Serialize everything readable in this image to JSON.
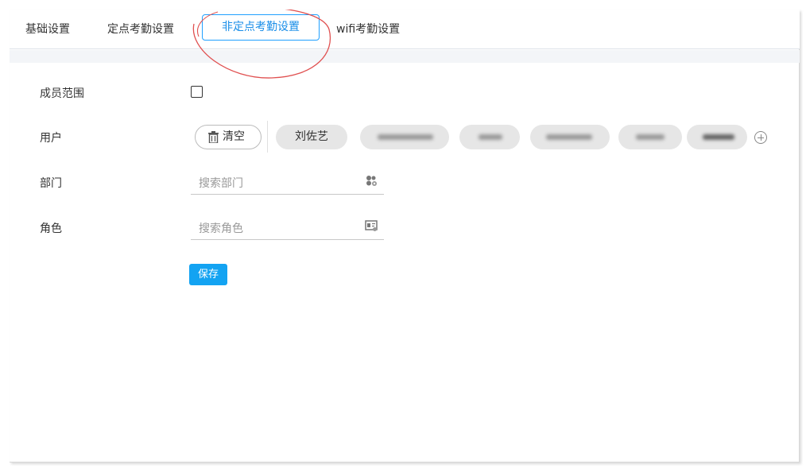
{
  "tabs": [
    {
      "label": "基础设置"
    },
    {
      "label": "定点考勤设置"
    },
    {
      "label": "非定点考勤设置"
    },
    {
      "label": "wifi考勤设置"
    }
  ],
  "active_tab_index": 2,
  "form": {
    "member_scope": {
      "label": "成员范围",
      "checked": false
    },
    "users": {
      "label": "用户",
      "clear_label": "清空",
      "chips": [
        {
          "name": "刘佐艺"
        },
        {
          "name": "",
          "blurred": true
        },
        {
          "name": "",
          "blurred": true
        },
        {
          "name": "",
          "blurred": true
        },
        {
          "name": "",
          "blurred": true
        },
        {
          "name": "",
          "blurred": true
        }
      ],
      "add_icon": "plus-circle-icon"
    },
    "department": {
      "label": "部门",
      "placeholder": "搜索部门",
      "icon": "group-icon"
    },
    "role": {
      "label": "角色",
      "placeholder": "搜索角色",
      "icon": "id-card-icon"
    },
    "save_label": "保存"
  },
  "colors": {
    "accent": "#20a0ff",
    "save_button": "#13a3f2",
    "annotation_circle": "#e05050"
  }
}
